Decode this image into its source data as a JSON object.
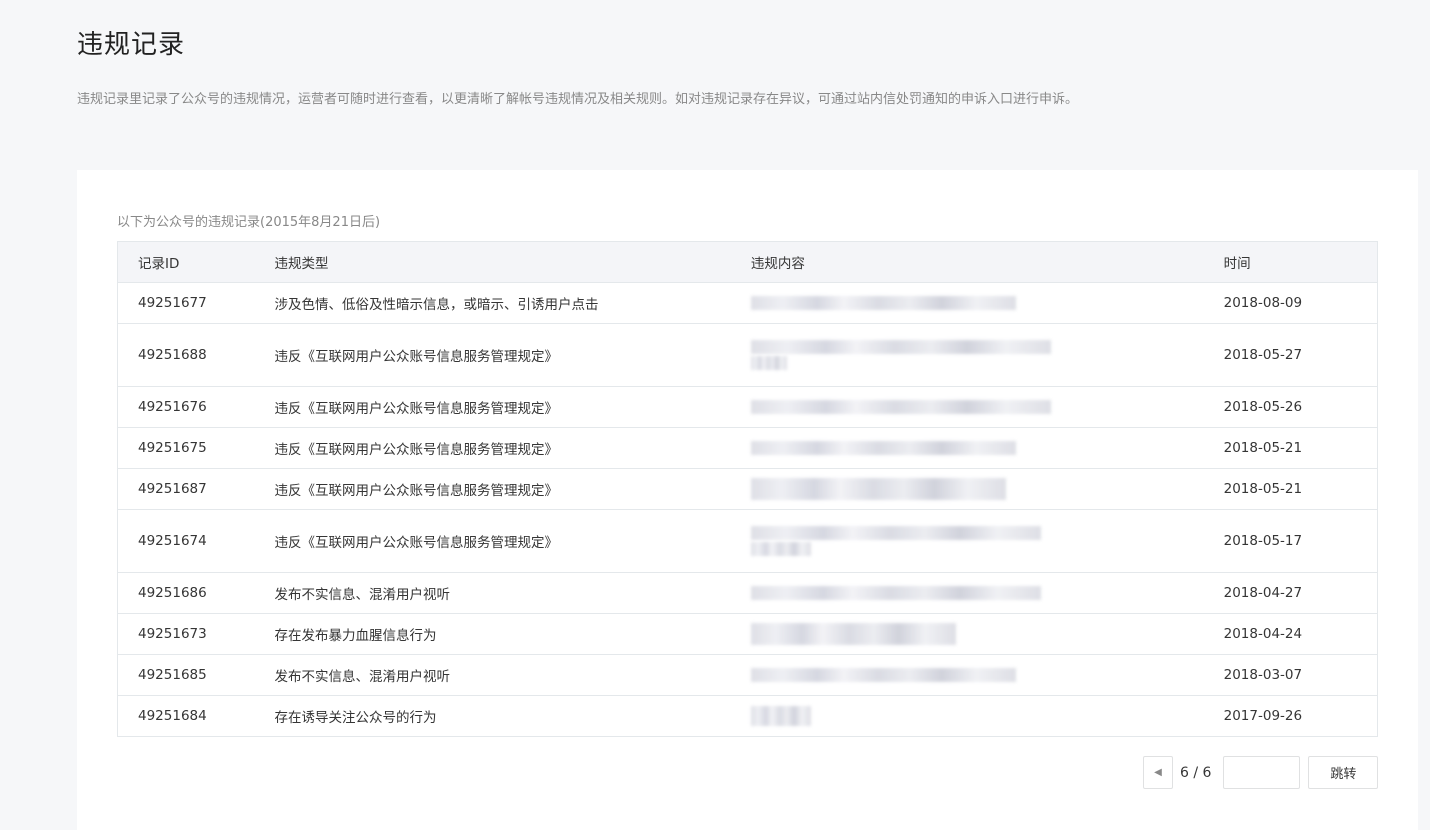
{
  "page": {
    "title": "违规记录",
    "description": "违规记录里记录了公众号的违规情况，运营者可随时进行查看，以更清晰了解帐号违规情况及相关规则。如对违规记录存在异议，可通过站内信处罚通知的申诉入口进行申诉。"
  },
  "card": {
    "caption": "以下为公众号的违规记录(2015年8月21日后)"
  },
  "table": {
    "headers": {
      "id": "记录ID",
      "type": "违规类型",
      "content": "违规内容",
      "time": "时间"
    },
    "rows": [
      {
        "id": "49251677",
        "type": "涉及色情、低俗及性暗示信息，或暗示、引诱用户点击",
        "time": "2018-08-09"
      },
      {
        "id": "49251688",
        "type": "违反《互联网用户公众账号信息服务管理规定》",
        "time": "2018-05-27"
      },
      {
        "id": "49251676",
        "type": "违反《互联网用户公众账号信息服务管理规定》",
        "time": "2018-05-26"
      },
      {
        "id": "49251675",
        "type": "违反《互联网用户公众账号信息服务管理规定》",
        "time": "2018-05-21"
      },
      {
        "id": "49251687",
        "type": "违反《互联网用户公众账号信息服务管理规定》",
        "time": "2018-05-21"
      },
      {
        "id": "49251674",
        "type": "违反《互联网用户公众账号信息服务管理规定》",
        "time": "2018-05-17"
      },
      {
        "id": "49251686",
        "type": "发布不实信息、混淆用户视听",
        "time": "2018-04-27"
      },
      {
        "id": "49251673",
        "type": "存在发布暴力血腥信息行为",
        "time": "2018-04-24"
      },
      {
        "id": "49251685",
        "type": "发布不实信息、混淆用户视听",
        "time": "2018-03-07"
      },
      {
        "id": "49251684",
        "type": "存在诱导关注公众号的行为",
        "time": "2017-09-26"
      }
    ]
  },
  "pager": {
    "page_text": "6 / 6",
    "input_value": "",
    "jump_label": "跳转"
  }
}
